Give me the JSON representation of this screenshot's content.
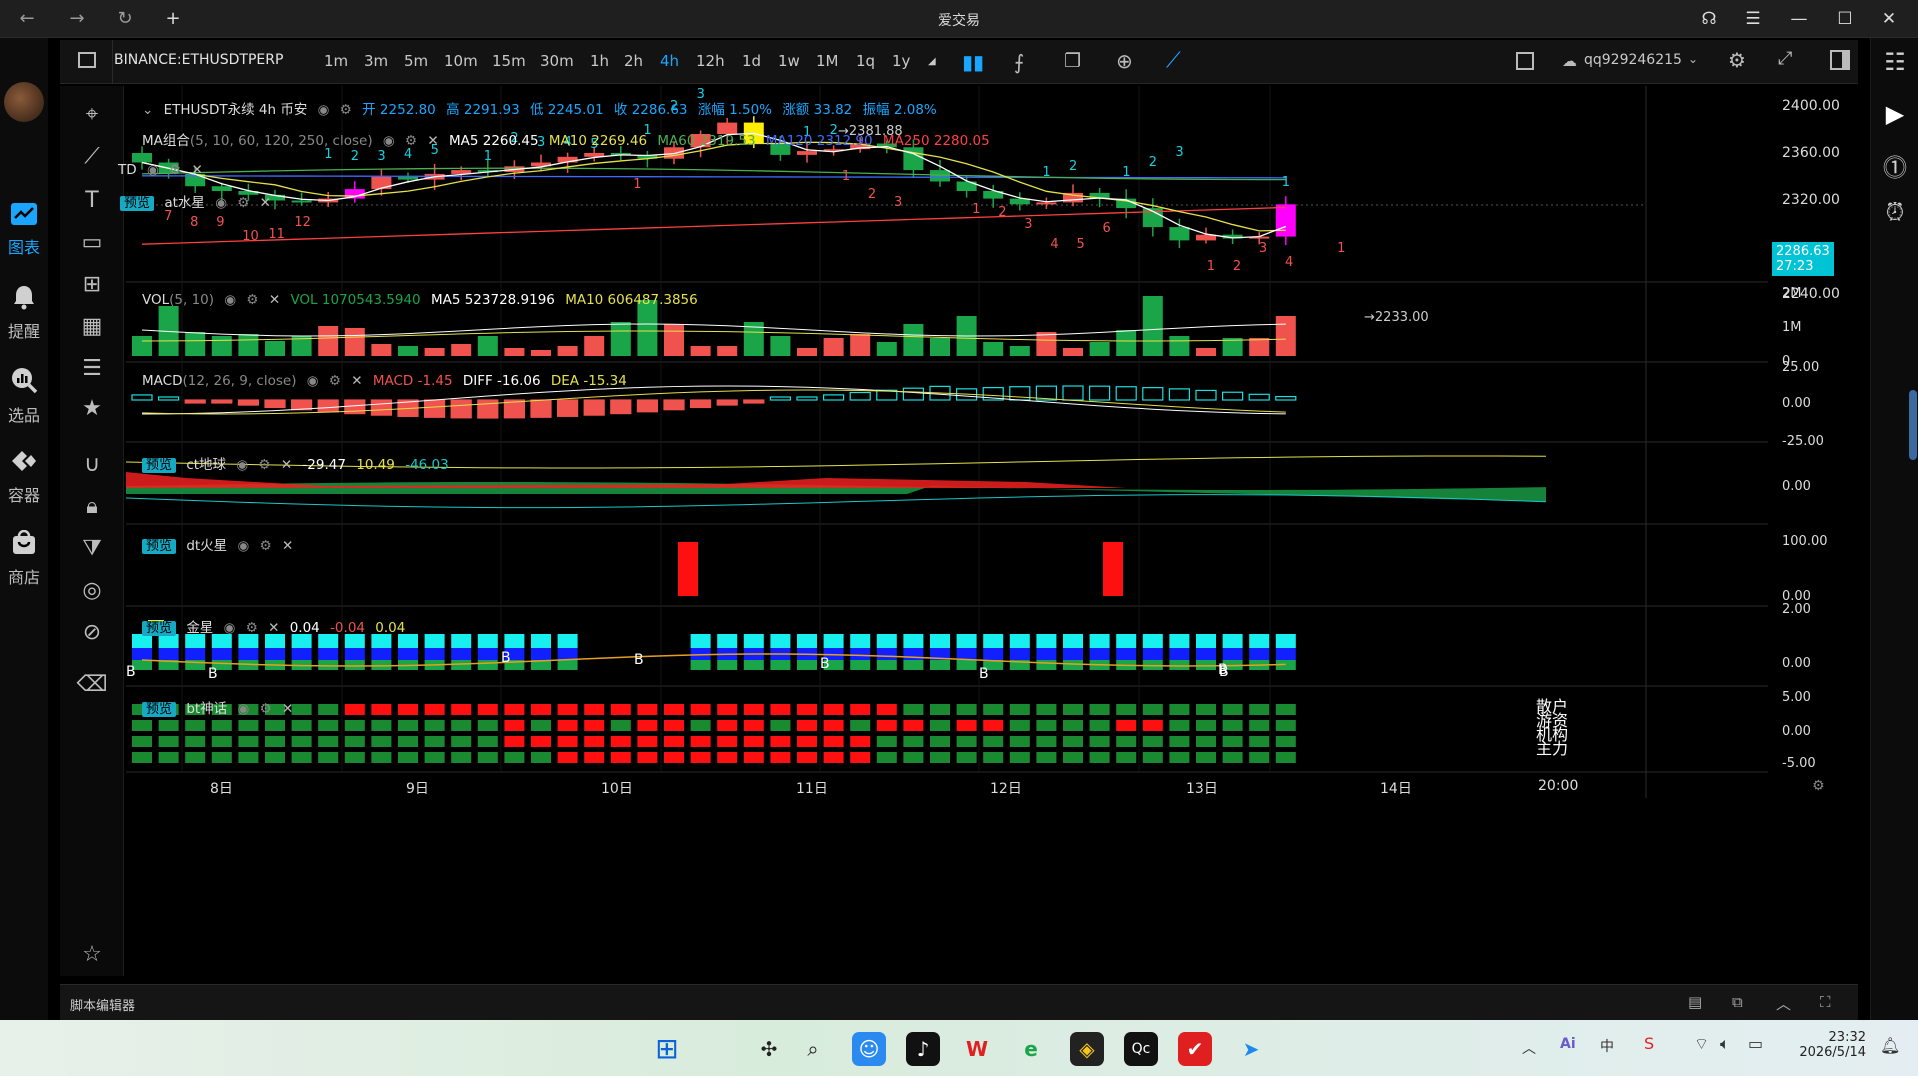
{
  "app": {
    "title": "爱交易"
  },
  "left_nav": [
    {
      "label": "图表",
      "icon": "chart-icon",
      "active": true
    },
    {
      "label": "提醒",
      "icon": "bell-icon",
      "active": false
    },
    {
      "label": "选品",
      "icon": "search-icon",
      "active": false
    },
    {
      "label": "容器",
      "icon": "container-icon",
      "active": false
    },
    {
      "label": "商店",
      "icon": "store-icon",
      "active": false
    }
  ],
  "toolbar": {
    "symbol": "BINANCE:ETHUSDTPERP",
    "timeframes": [
      "1m",
      "3m",
      "5m",
      "10m",
      "15m",
      "30m",
      "1h",
      "2h",
      "4h",
      "12h",
      "1d",
      "1w",
      "1M",
      "1q",
      "1y"
    ],
    "active_timeframe": "4h",
    "user": "qq929246215"
  },
  "chart": {
    "header": {
      "title": "ETHUSDT永续 4h 币安",
      "open": "开 2252.80",
      "high": "高 2291.93",
      "low": "低 2245.01",
      "close": "收 2286.63",
      "change_pct": "涨幅 1.50%",
      "change_amt": "涨额 33.82",
      "amplitude": "振幅 2.08%"
    },
    "ma": {
      "label": "MA组合",
      "params": "(5, 10, 60, 120, 250, close)",
      "ma5": "MA5 2260.45",
      "ma10": "MA10 2269.46",
      "ma60": "MA60 2319.53",
      "ma120": "MA120 2312.90",
      "ma250": "MA250 2280.05"
    },
    "td_label": "TD",
    "at_tag": "预览",
    "at_label": "at水星",
    "price_axis": [
      "2400.00",
      "2360.00",
      "2320.00",
      "2280.00",
      "2240.00"
    ],
    "current_price": "2286.63",
    "countdown": "27:23",
    "high_marker": "2381.88",
    "low_marker": "2233.00",
    "td_up_labels": [
      "1",
      "2",
      "3",
      "4",
      "5",
      "1",
      "2",
      "3",
      "4",
      "5",
      "1",
      "2",
      "3",
      "1",
      "2",
      "1",
      "2",
      "1",
      "2",
      "3",
      "1"
    ],
    "td_down_labels": [
      "5",
      "7",
      "8",
      "9",
      "10",
      "11",
      "12",
      "1",
      "1",
      "2",
      "3",
      "1",
      "2",
      "3",
      "4",
      "5",
      "6",
      "1",
      "2",
      "3",
      "4",
      "1"
    ],
    "vol": {
      "label": "VOL",
      "params": "(5, 10)",
      "vol": "VOL 1070543.5940",
      "ma5": "MA5 523728.9196",
      "ma10": "MA10 606487.3856",
      "axis": [
        "2M",
        "1M",
        "0"
      ]
    },
    "macd": {
      "label": "MACD",
      "params": "(12, 26, 9, close)",
      "macd": "MACD -1.45",
      "diff": "DIFF -16.06",
      "dea": "DEA -15.34",
      "axis": [
        "25.00",
        "0.00",
        "-25.00"
      ]
    },
    "ct": {
      "tag": "预览",
      "label": "ct地球",
      "v1": "-29.47",
      "v2": "10.49",
      "v3": "-46.03",
      "axis": [
        "0.00"
      ]
    },
    "dt": {
      "tag": "预览",
      "label": "dt火星",
      "axis": [
        "100.00",
        "0.00"
      ]
    },
    "jin": {
      "tag": "预览",
      "label": "金星",
      "v1": "0.04",
      "v2": "-0.04",
      "v3": "0.04",
      "axis": [
        "2.00",
        "0.00"
      ],
      "b_labels": [
        "B",
        "B",
        "B",
        "B",
        "B",
        "B",
        "B",
        "B"
      ]
    },
    "bt": {
      "tag": "预览",
      "label": "bt神话",
      "axis": [
        "5.00",
        "0.00",
        "-5.00"
      ],
      "side_labels": [
        "散户",
        "游资",
        "机构",
        "主力"
      ]
    },
    "time_axis": [
      "8日",
      "9日",
      "10日",
      "11日",
      "12日",
      "13日",
      "14日",
      "20:00"
    ]
  },
  "status_bar": {
    "label": "脚本编辑器"
  },
  "taskbar": {
    "time": "23:32",
    "date": "2026/5/14"
  },
  "colors": {
    "up": "#f0534e",
    "down": "#1aa548",
    "accent": "#1aa6ff",
    "ma5": "#ffffff",
    "ma10": "#e5e14a",
    "ma60": "#4caf50",
    "ma120": "#3f6bff",
    "ma250": "#ff4040"
  }
}
